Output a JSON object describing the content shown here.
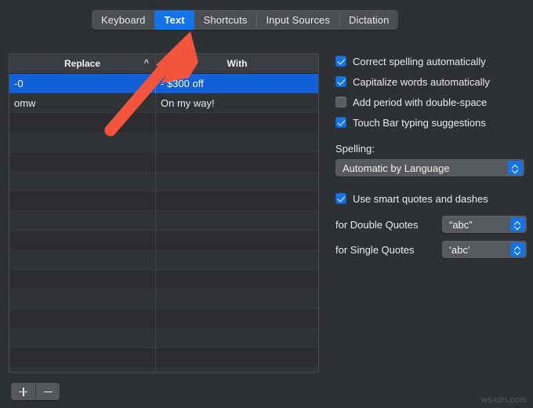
{
  "window": {
    "title": "Keyboard",
    "background_color": "#2e3134"
  },
  "tabs": [
    {
      "label": "Keyboard",
      "selected": false
    },
    {
      "label": "Text",
      "selected": true
    },
    {
      "label": "Shortcuts",
      "selected": false
    },
    {
      "label": "Input Sources",
      "selected": false
    },
    {
      "label": "Dictation",
      "selected": false
    }
  ],
  "table": {
    "columns": [
      "Replace",
      "With"
    ],
    "sort_indicator": "^",
    "sort_column": "Replace",
    "rows": [
      {
        "replace": "-0",
        "with": "- $300 off",
        "selected": true
      },
      {
        "replace": "omw",
        "with": "On my way!",
        "selected": false
      }
    ],
    "empty_row_count": 14
  },
  "table_buttons": {
    "add_label": "+",
    "remove_label": "−"
  },
  "options": {
    "checkboxes": [
      {
        "label": "Correct spelling automatically",
        "checked": true
      },
      {
        "label": "Capitalize words automatically",
        "checked": true
      },
      {
        "label": "Add period with double-space",
        "checked": false
      },
      {
        "label": "Touch Bar typing suggestions",
        "checked": true
      }
    ],
    "spelling": {
      "label": "Spelling:",
      "value": "Automatic by Language"
    },
    "smart_quotes": {
      "label": "Use smart quotes and dashes",
      "checked": true,
      "double_quotes": {
        "label": "for Double Quotes",
        "value": "“abc”"
      },
      "single_quotes": {
        "label": "for Single Quotes",
        "value": "‘abc’"
      }
    }
  },
  "annotation": {
    "arrow_color": "#f4543c",
    "points_to": "Text"
  },
  "watermark": {
    "text": "wsxdn.com"
  },
  "colors": {
    "accent_blue": "#1274e8",
    "selection_blue": "#1160d8",
    "window_bg": "#2e3134",
    "table_bg": "#2b2d30",
    "annotation_red": "#f4543c"
  }
}
